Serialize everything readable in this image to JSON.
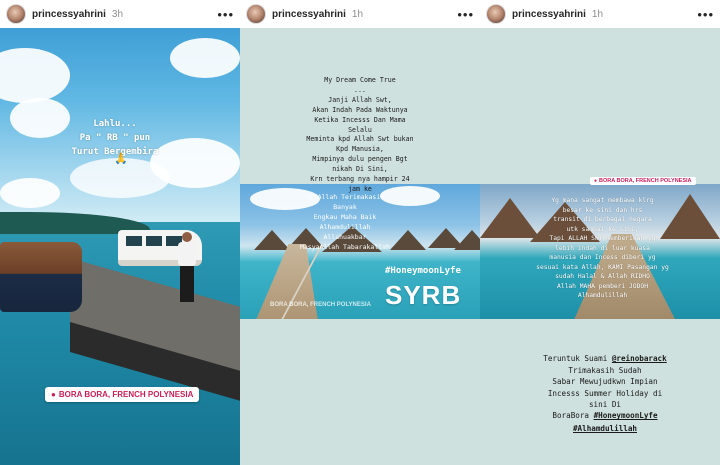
{
  "stories": [
    {
      "username": "princessyahrini",
      "time": "3h",
      "more_label": "•••",
      "overlay_text": "Lahlu...\nPa \" RB \" pun\nTurut Bergembira",
      "emoji": "🙏",
      "location": "BORA BORA, FRENCH POLYNESIA"
    },
    {
      "username": "princessyahrini",
      "time": "1h",
      "more_label": "•••",
      "top_text": "My Dream Come True\n...\nJanji Allah Swt,\nAkan Indah Pada Waktunya\nKetika Incesss Dan Mama\nSelalu\nMeminta kpd Allah Swt bukan\nKpd Manusia,\nMimpinya dulu pengen Bgt\nnikah Di Sini,\nKrn terbang nya hampir 24\njam ke",
      "photo_overlay": "Ya Allah Terimakasih\nBanyak\nEngkau Maha Baik\nAlhamdulillah\nAllahuakbar\nMasyaAllah Tabarakallah",
      "hashtag": "#HoneymoonLyfe",
      "sticker": "SYRB",
      "watermark": "BORA BORA, FRENCH POLYNESIA"
    },
    {
      "username": "princessyahrini",
      "time": "1h",
      "more_label": "•••",
      "location": "BORA BORA, FRENCH POLYNESIA",
      "photo_overlay": "Yg mana sangat membawa klrg\nbesar ke sini dan hrs\ntransit di berbagai negara\nutk sampai ke sini,\nTapi ALLAH SWT memberikan yg\nlebih indah di luar kuasa\nmanusia dan Incess diberi yg\nsesuai kata Allah, KAMI Pasangan yg\nsudah Halal & Allah RIDHO\nAllah MAHA pemberi JODOH\nAlhamdulillah",
      "bottom_prefix": "Teruntuk Suami ",
      "mention": "@reinobarack",
      "bottom_text": "Trimakasih Sudah\nSabar Mewujudkwn Impian\nIncesss Summer Holiday di\nsini Di\nBoraBora ",
      "bottom_hashtag": "#HoneymoonLyfe",
      "final_hashtag": "#Alhamdulillah"
    }
  ],
  "colors": {
    "location_pink": "#c91e5a",
    "header_text": "#262626",
    "time_grey": "#8e8e8e"
  },
  "icons": [
    "avatar",
    "more-options-icon",
    "location-pin-icon"
  ]
}
